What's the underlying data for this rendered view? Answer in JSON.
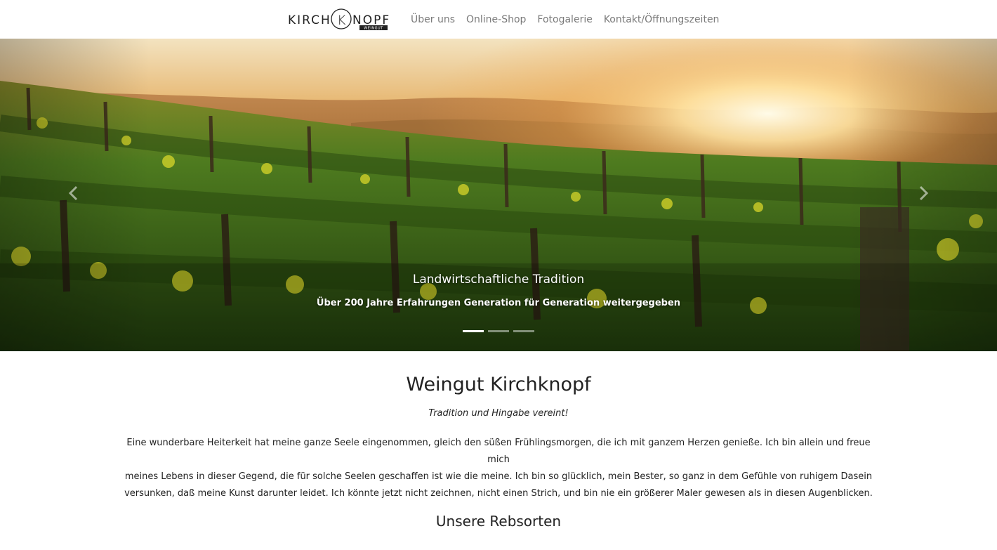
{
  "brand": {
    "logo_text_left": "KIRCH",
    "logo_text_right": "NOPF",
    "logo_monogram": "K",
    "logo_sub": "WEINGUT"
  },
  "nav": {
    "items": [
      {
        "label": "Über uns"
      },
      {
        "label": "Online-Shop"
      },
      {
        "label": "Fotogalerie"
      },
      {
        "label": "Kontakt/Öffnungszeiten"
      }
    ]
  },
  "hero": {
    "caption_title": "Landwirtschaftliche Tradition",
    "caption_text": "Über 200 Jahre Erfahrungen Generation für Generation weitergegeben",
    "slide_count": 3,
    "active_slide": 1,
    "prev_icon": "chevron-left-icon",
    "next_icon": "chevron-right-icon"
  },
  "main": {
    "title": "Weingut Kirchknopf",
    "subtitle": "Tradition und Hingabe vereint!",
    "intro_line_1": "Eine wunderbare Heiterkeit hat meine ganze Seele eingenommen, gleich den süßen Frühlingsmorgen, die ich mit ganzem Herzen genieße. Ich bin allein und freue mich",
    "intro_line_2": "meines Lebens in dieser Gegend, die für solche Seelen geschaffen ist wie die meine. Ich bin so glücklich, mein Bester, so ganz in dem Gefühle von ruhigem Dasein",
    "intro_line_3": "versunken, daß meine Kunst darunter leidet. Ich könnte jetzt nicht zeichnen, nicht einen Strich, und bin nie ein größerer Maler gewesen als in diesen Augenblicken.",
    "section_title": "Unsere Rebsorten"
  },
  "colors": {
    "nav_text": "#7a7a7a",
    "body_text": "#222222",
    "sun": "#ffdf9a",
    "grass": "#3f6a1c"
  }
}
